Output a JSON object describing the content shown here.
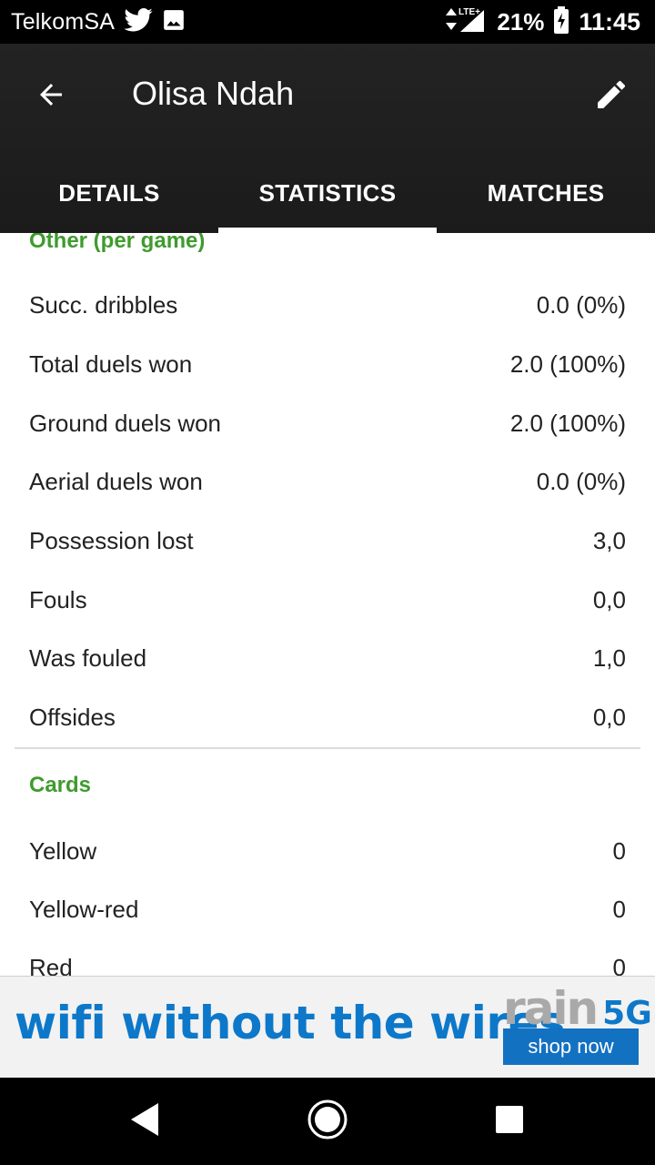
{
  "status_bar": {
    "carrier": "TelkomSA",
    "network": "LTE+",
    "battery": "21%",
    "time": "11:45"
  },
  "app_bar": {
    "title": "Olisa Ndah",
    "tabs": [
      {
        "label": "DETAILS",
        "active": false
      },
      {
        "label": "STATISTICS",
        "active": true
      },
      {
        "label": "MATCHES",
        "active": false
      }
    ]
  },
  "sections": {
    "other": {
      "title": "Other (per game)",
      "rows": [
        {
          "label": "Succ. dribbles",
          "value": "0.0 (0%)"
        },
        {
          "label": "Total duels won",
          "value": "2.0 (100%)"
        },
        {
          "label": "Ground duels won",
          "value": "2.0 (100%)"
        },
        {
          "label": "Aerial duels won",
          "value": "0.0 (0%)"
        },
        {
          "label": "Possession lost",
          "value": "3,0"
        },
        {
          "label": "Fouls",
          "value": "0,0"
        },
        {
          "label": "Was fouled",
          "value": "1,0"
        },
        {
          "label": "Offsides",
          "value": "0,0"
        }
      ]
    },
    "cards": {
      "title": "Cards",
      "rows": [
        {
          "label": "Yellow",
          "value": "0"
        },
        {
          "label": "Yellow-red",
          "value": "0"
        },
        {
          "label": "Red",
          "value": "0"
        }
      ]
    }
  },
  "ad": {
    "headline": "wifi without the wires",
    "brand": "rain",
    "brand_suffix": "5G",
    "cta": "shop now"
  },
  "colors": {
    "accent_green": "#3f9b2e",
    "ad_blue": "#0d78c9",
    "app_bar": "#1f1f1f"
  }
}
